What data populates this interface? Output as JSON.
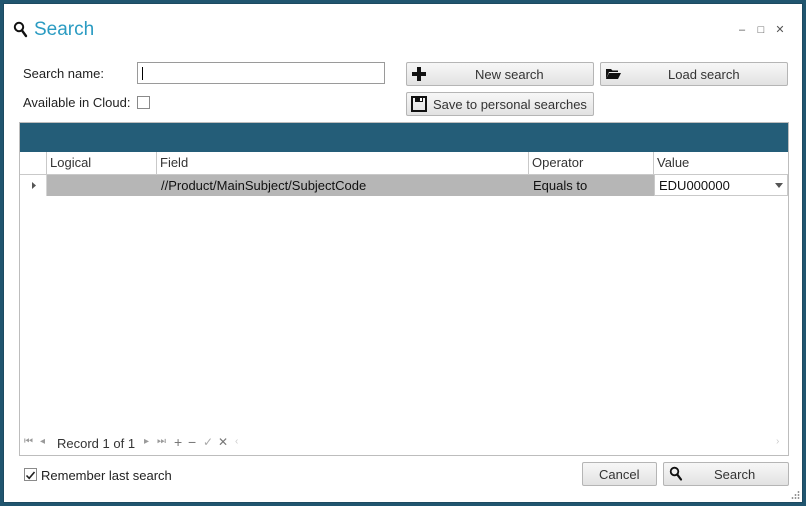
{
  "window": {
    "title": "Search",
    "controls": {
      "minimize": "–",
      "maximize": "□",
      "close": "✕"
    }
  },
  "form": {
    "search_name_label": "Search name:",
    "search_name_value": "",
    "cloud_label": "Available in Cloud:",
    "cloud_checked": false
  },
  "toolbar": {
    "new_search": "New search",
    "load_search": "Load search",
    "save_personal": "Save to personal searches"
  },
  "grid": {
    "columns": [
      "Logical",
      "Field",
      "Operator",
      "Value"
    ],
    "rows": [
      {
        "logical": "",
        "field": "//Product/MainSubject/SubjectCode",
        "operator": "Equals to",
        "value": "EDU000000"
      }
    ],
    "pager": {
      "record_text": "Record 1 of 1",
      "first": "⏮",
      "prev": "◂",
      "next": "▸",
      "last": "⏭",
      "add": "+",
      "remove": "−",
      "confirm": "✓",
      "cancel": "✕"
    }
  },
  "footer": {
    "remember_label": "Remember last search",
    "remember_checked": true,
    "cancel": "Cancel",
    "search": "Search"
  },
  "colors": {
    "title": "#2a9bc2",
    "grid_band": "#245d78",
    "row_highlight": "#b6b6b6"
  }
}
